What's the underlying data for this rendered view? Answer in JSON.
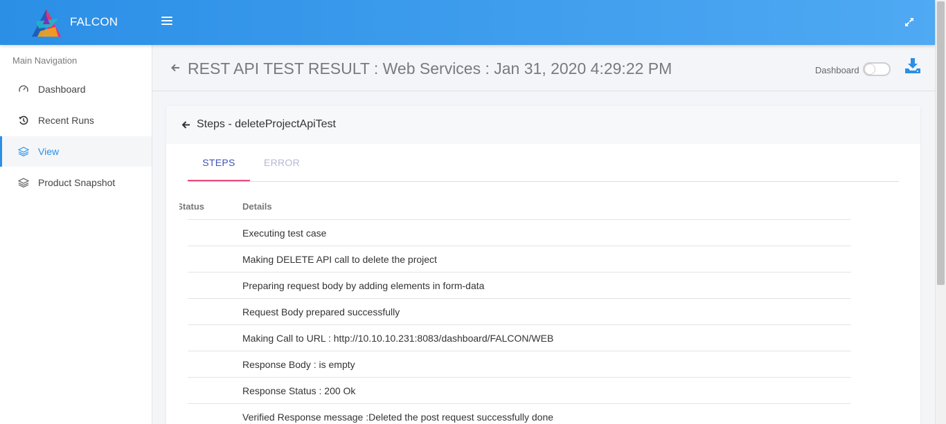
{
  "app": {
    "name": "FALCON",
    "brand_colors": {
      "primary": "#2b8fe6",
      "accent": "#e84a7a"
    }
  },
  "header": {
    "menu_icon": "hamburger-icon",
    "expand_icon": "expand-icon"
  },
  "sidebar": {
    "title": "Main Navigation",
    "items": [
      {
        "label": "Dashboard",
        "icon": "gauge-icon",
        "active": false
      },
      {
        "label": "Recent Runs",
        "icon": "history-icon",
        "active": false
      },
      {
        "label": "View",
        "icon": "layers-icon",
        "active": true
      },
      {
        "label": "Product Snapshot",
        "icon": "layers-icon",
        "active": false
      }
    ]
  },
  "page": {
    "title": "REST API TEST RESULT : Web Services : Jan 31, 2020 4:29:22 PM",
    "dashboard_toggle_label": "Dashboard",
    "dashboard_toggle_on": false
  },
  "card": {
    "title": "Steps - deleteProjectApiTest",
    "tabs": [
      {
        "label": "STEPS",
        "active": true
      },
      {
        "label": "ERROR",
        "active": false
      }
    ],
    "table": {
      "columns": [
        "Status",
        "Details"
      ],
      "rows": [
        "Executing test case",
        "Making DELETE API call to delete the project",
        "Preparing request body by adding elements in form-data",
        "Request Body prepared successfully",
        "Making Call to URL : http://10.10.10.231:8083/dashboard/FALCON/WEB",
        "Response Body : is empty",
        "Response Status : 200 Ok",
        "Verified Response message :Deleted the post request successfully done"
      ]
    }
  }
}
